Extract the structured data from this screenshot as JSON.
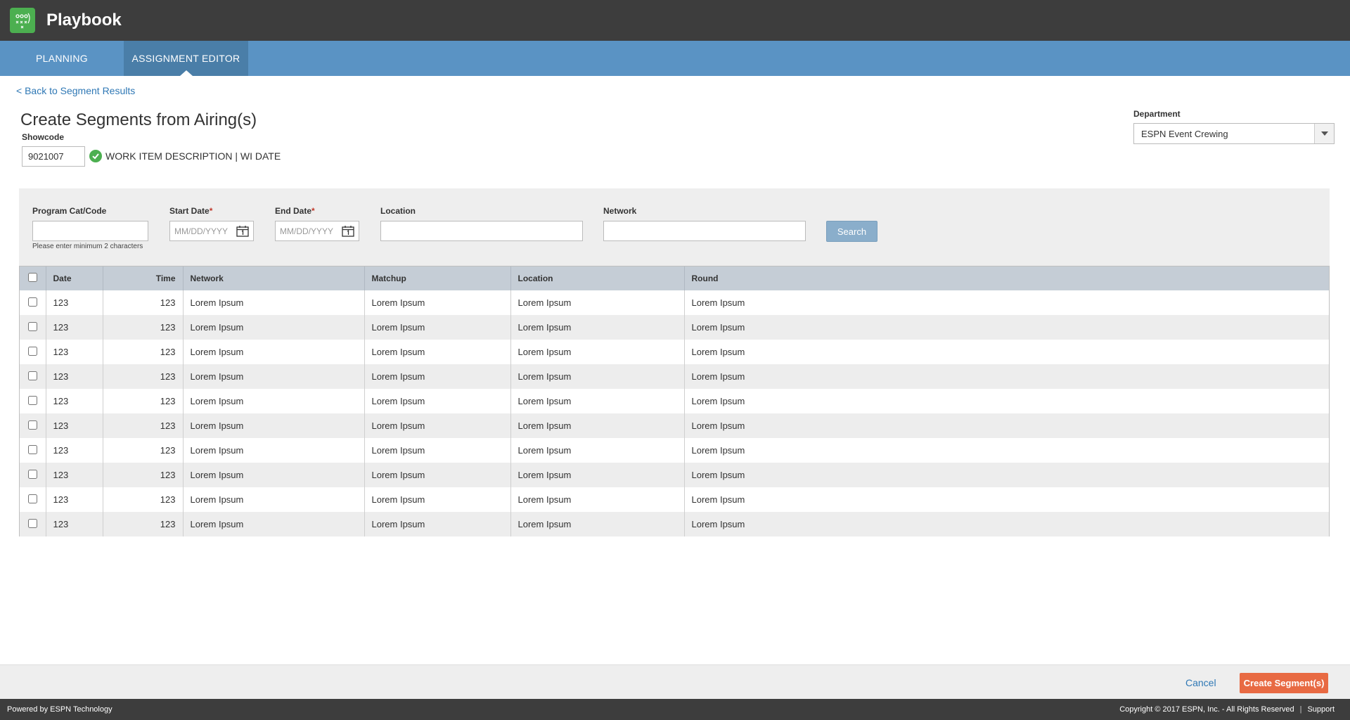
{
  "app": {
    "title": "Playbook"
  },
  "nav": {
    "tabs": [
      {
        "label": "PLANNING"
      },
      {
        "label": "ASSIGNMENT EDITOR"
      }
    ]
  },
  "back_link": "< Back to Segment Results",
  "page_title": "Create Segments from Airing(s)",
  "showcode": {
    "label": "Showcode",
    "value": "9021007",
    "description": "WORK ITEM DESCRIPTION | WI DATE"
  },
  "department": {
    "label": "Department",
    "value": "ESPN Event Crewing"
  },
  "filters": {
    "program_label": "Program Cat/Code",
    "program_hint": "Please enter minimum 2 characters",
    "start_label": "Start Date",
    "end_label": "End Date",
    "required_mark": "*",
    "date_placeholder": "MM/DD/YYYY",
    "location_label": "Location",
    "network_label": "Network",
    "search_label": "Search"
  },
  "table": {
    "headers": [
      "Date",
      "Time",
      "Network",
      "Matchup",
      "Location",
      "Round"
    ],
    "rows": [
      [
        "123",
        "123",
        "Lorem Ipsum",
        "Lorem Ipsum",
        "Lorem Ipsum",
        "Lorem Ipsum"
      ],
      [
        "123",
        "123",
        "Lorem Ipsum",
        "Lorem Ipsum",
        "Lorem Ipsum",
        "Lorem Ipsum"
      ],
      [
        "123",
        "123",
        "Lorem Ipsum",
        "Lorem Ipsum",
        "Lorem Ipsum",
        "Lorem Ipsum"
      ],
      [
        "123",
        "123",
        "Lorem Ipsum",
        "Lorem Ipsum",
        "Lorem Ipsum",
        "Lorem Ipsum"
      ],
      [
        "123",
        "123",
        "Lorem Ipsum",
        "Lorem Ipsum",
        "Lorem Ipsum",
        "Lorem Ipsum"
      ],
      [
        "123",
        "123",
        "Lorem Ipsum",
        "Lorem Ipsum",
        "Lorem Ipsum",
        "Lorem Ipsum"
      ],
      [
        "123",
        "123",
        "Lorem Ipsum",
        "Lorem Ipsum",
        "Lorem Ipsum",
        "Lorem Ipsum"
      ],
      [
        "123",
        "123",
        "Lorem Ipsum",
        "Lorem Ipsum",
        "Lorem Ipsum",
        "Lorem Ipsum"
      ],
      [
        "123",
        "123",
        "Lorem Ipsum",
        "Lorem Ipsum",
        "Lorem Ipsum",
        "Lorem Ipsum"
      ],
      [
        "123",
        "123",
        "Lorem Ipsum",
        "Lorem Ipsum",
        "Lorem Ipsum",
        "Lorem Ipsum"
      ]
    ]
  },
  "actions": {
    "cancel": "Cancel",
    "create": "Create Segment(s)"
  },
  "footer": {
    "left": "Powered by ESPN Technology",
    "copyright": "Copyright © 2017 ESPN, Inc. - All Rights Reserved",
    "separator": "|",
    "support": "Support"
  },
  "colors": {
    "topbar": "#3d3d3d",
    "nav": "#5a93c4",
    "nav_active": "#4a7ea8",
    "link": "#2f78b5",
    "create_button": "#e86a43",
    "success": "#4caf50"
  },
  "icons": {
    "logo": "playbook-logo-icon",
    "check": "check-circle-icon",
    "calendar": "calendar-icon",
    "dropdown": "chevron-down-icon"
  }
}
